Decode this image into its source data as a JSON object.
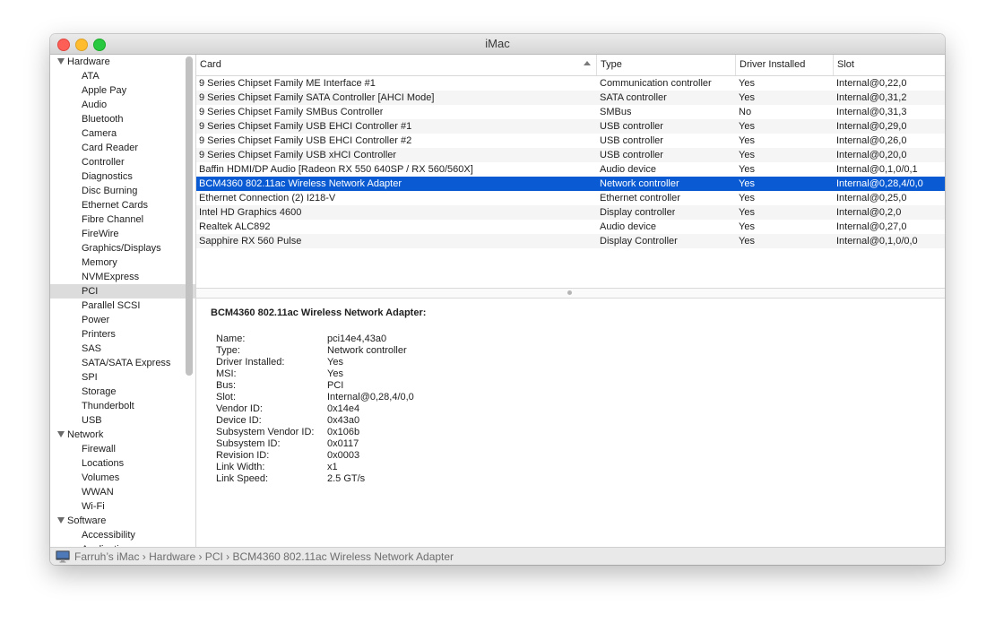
{
  "window": {
    "title": "iMac"
  },
  "sidebar": {
    "groups": [
      {
        "label": "Hardware",
        "items": [
          "ATA",
          "Apple Pay",
          "Audio",
          "Bluetooth",
          "Camera",
          "Card Reader",
          "Controller",
          "Diagnostics",
          "Disc Burning",
          "Ethernet Cards",
          "Fibre Channel",
          "FireWire",
          "Graphics/Displays",
          "Memory",
          "NVMExpress",
          "PCI",
          "Parallel SCSI",
          "Power",
          "Printers",
          "SAS",
          "SATA/SATA Express",
          "SPI",
          "Storage",
          "Thunderbolt",
          "USB"
        ]
      },
      {
        "label": "Network",
        "items": [
          "Firewall",
          "Locations",
          "Volumes",
          "WWAN",
          "Wi-Fi"
        ]
      },
      {
        "label": "Software",
        "items": [
          "Accessibility",
          "Applications"
        ]
      }
    ],
    "selected": "PCI"
  },
  "table": {
    "columns": [
      "Card",
      "Type",
      "Driver Installed",
      "Slot"
    ],
    "sorted_column": "Card",
    "selected_index": 7,
    "rows": [
      [
        "9 Series Chipset Family ME Interface #1",
        "Communication controller",
        "Yes",
        "Internal@0,22,0"
      ],
      [
        "9 Series Chipset Family SATA Controller [AHCI Mode]",
        "SATA controller",
        "Yes",
        "Internal@0,31,2"
      ],
      [
        "9 Series Chipset Family SMBus Controller",
        "SMBus",
        "No",
        "Internal@0,31,3"
      ],
      [
        "9 Series Chipset Family USB EHCI Controller #1",
        "USB controller",
        "Yes",
        "Internal@0,29,0"
      ],
      [
        "9 Series Chipset Family USB EHCI Controller #2",
        "USB controller",
        "Yes",
        "Internal@0,26,0"
      ],
      [
        "9 Series Chipset Family USB xHCI Controller",
        "USB controller",
        "Yes",
        "Internal@0,20,0"
      ],
      [
        "Baffin HDMI/DP Audio [Radeon RX 550 640SP / RX 560/560X]",
        "Audio device",
        "Yes",
        "Internal@0,1,0/0,1"
      ],
      [
        "BCM4360 802.11ac Wireless Network Adapter",
        "Network controller",
        "Yes",
        "Internal@0,28,4/0,0"
      ],
      [
        "Ethernet Connection (2) I218-V",
        "Ethernet controller",
        "Yes",
        "Internal@0,25,0"
      ],
      [
        "Intel HD Graphics 4600",
        "Display controller",
        "Yes",
        "Internal@0,2,0"
      ],
      [
        "Realtek ALC892",
        "Audio device",
        "Yes",
        "Internal@0,27,0"
      ],
      [
        "Sapphire RX 560 Pulse",
        "Display Controller",
        "Yes",
        "Internal@0,1,0/0,0"
      ]
    ]
  },
  "detail": {
    "title": "BCM4360 802.11ac Wireless Network Adapter:",
    "properties": [
      {
        "key": "Name:",
        "value": "pci14e4,43a0"
      },
      {
        "key": "Type:",
        "value": "Network controller"
      },
      {
        "key": "Driver Installed:",
        "value": "Yes"
      },
      {
        "key": "MSI:",
        "value": "Yes"
      },
      {
        "key": "Bus:",
        "value": "PCI"
      },
      {
        "key": "Slot:",
        "value": "Internal@0,28,4/0,0"
      },
      {
        "key": "Vendor ID:",
        "value": "0x14e4"
      },
      {
        "key": "Device ID:",
        "value": "0x43a0"
      },
      {
        "key": "Subsystem Vendor ID:",
        "value": "0x106b"
      },
      {
        "key": "Subsystem ID:",
        "value": "0x0117"
      },
      {
        "key": "Revision ID:",
        "value": "0x0003"
      },
      {
        "key": "Link Width:",
        "value": "x1"
      },
      {
        "key": "Link Speed:",
        "value": "2.5 GT/s"
      }
    ]
  },
  "statusbar": {
    "icon": "imac-icon",
    "path": "Farruh’s iMac › Hardware › PCI › BCM4360 802.11ac Wireless Network Adapter"
  },
  "colors": {
    "selection": "#0a5bd3",
    "sidebar_selection": "#dcdcdc"
  }
}
